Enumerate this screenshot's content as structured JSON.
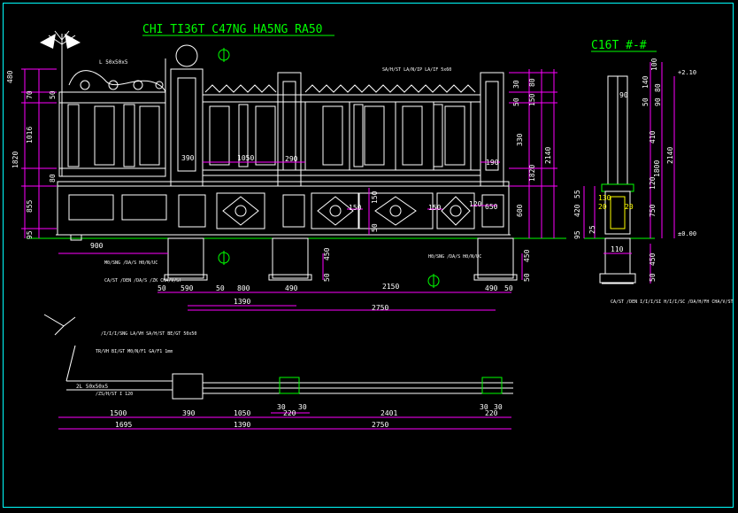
{
  "titles": {
    "main": "CHI TI36T C47NG HA5NG RA50",
    "section": "C16T #-#"
  },
  "colors": {
    "background": "#000000",
    "lines": "#ffffff",
    "dimension": "#ff00ff",
    "title": "#00ff00",
    "accent_yellow": "#ffff00",
    "accent_cyan": "#00ffff",
    "accent_red": "#ff0000"
  },
  "left_dims": [
    "480",
    "70",
    "50",
    "1016",
    "1820",
    "80",
    "855",
    "95"
  ],
  "right_dims": [
    "30",
    "80",
    "150",
    "50",
    "330",
    "1820",
    "2140",
    "600",
    "150",
    "50"
  ],
  "elev_dims_bottom": [
    "50",
    "590",
    "50",
    "800",
    "490",
    "2150",
    "490",
    "50"
  ],
  "elev_totals": [
    "1390",
    "2750"
  ],
  "inner_dims": [
    "390",
    "1050",
    "290",
    "190",
    "150",
    "150",
    "120",
    "650"
  ],
  "foundation_dims": [
    "450",
    "50",
    "450",
    "50"
  ],
  "base_left": "900",
  "labels": {
    "finial": "L 50x50x5",
    "top_note": "SA/H/ST LA/N/IP LA/IF 5x60",
    "base_note_1": "M0/SNG /DA/S H0/N/UC",
    "base_note_2": "CA/ST /DEN /DA/S /ZK CHA/V/ST",
    "base_note_3": "H0/SNG /DA/S H0/N/UC",
    "section_note": "CA/ST /DEN I/I/I/SI H/I/I/SC /DA/H/FH CHA/V/ST",
    "plan_note_1": "/I/I/I/SNG LA/VH SA/H/ST BE/GT 50x50",
    "plan_note_2": "TR/VH BI/GT M0/N/F1 GA/F1 1mm",
    "plan_note_3": "2L 50x50x5",
    "plan_note_4": "/ZS/H/ST I 120",
    "level_top": "+2.10",
    "level_base": "±0.00"
  },
  "section_dims": [
    "100",
    "140",
    "80",
    "30",
    "90",
    "50",
    "410",
    "1800",
    "2140",
    "120",
    "55",
    "420",
    "750",
    "95",
    "25",
    "110",
    "50",
    "450",
    "130",
    "20",
    "20",
    "20"
  ],
  "plan_dims_top": [
    "1500",
    "390",
    "1050",
    "30",
    "30",
    "2401",
    "30",
    "30"
  ],
  "plan_dims_mid": [
    "220",
    "220"
  ],
  "plan_dims_bottom": [
    "1695",
    "1390",
    "2750"
  ]
}
